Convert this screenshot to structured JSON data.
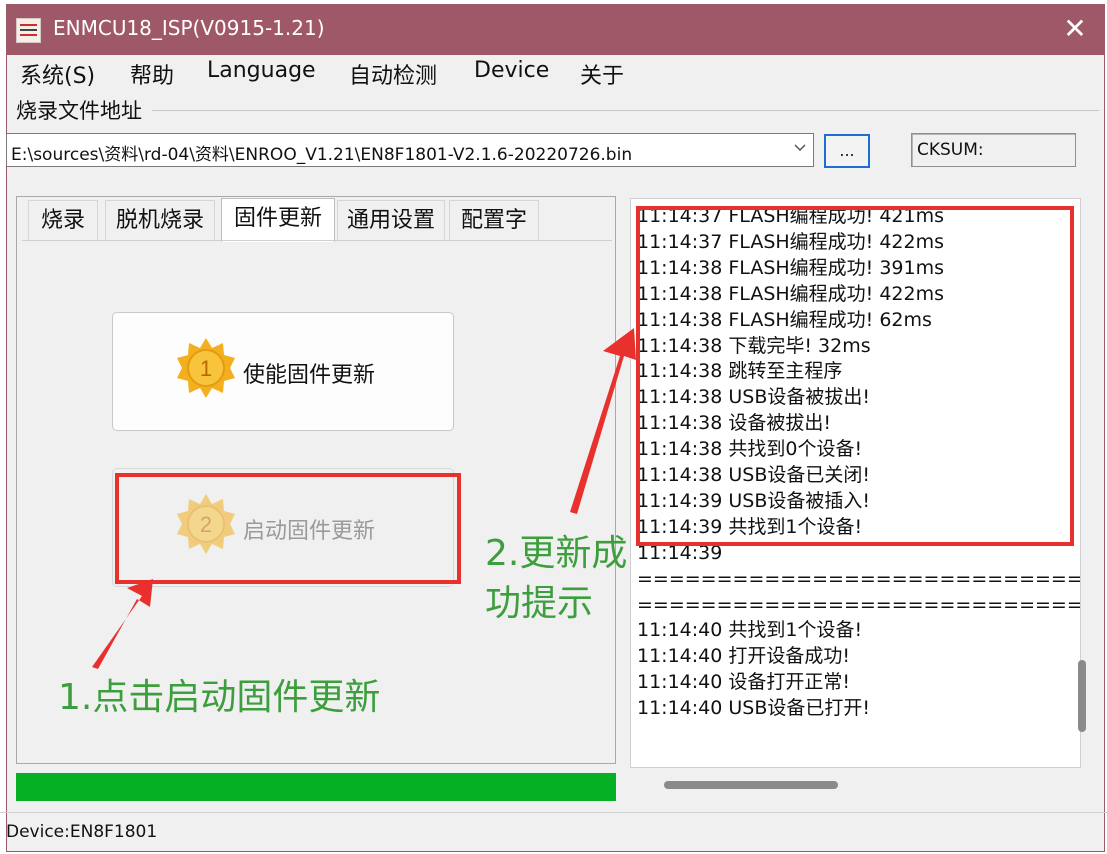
{
  "window": {
    "title": "ENMCU18_ISP(V0915-1.21)",
    "close_glyph": "✕",
    "accent": "#9f5867"
  },
  "menu": [
    "系统(S)",
    "帮助",
    "Language",
    "自动检测",
    "Device",
    "关于"
  ],
  "file_group": {
    "label": "烧录文件地址",
    "path": "E:\\sources\\资料\\rd-04\\资料\\ENROO_V1.21\\EN8F1801-V2.1.6-20220726.bin",
    "dropdown_icon": "chevron-down-icon",
    "browse_label": "...",
    "cksum_label": "CKSUM:"
  },
  "tabs": [
    "烧录",
    "脱机烧录",
    "固件更新",
    "通用设置",
    "配置字"
  ],
  "active_tab": "固件更新",
  "firmware": {
    "enable_button": {
      "badge": "1",
      "label": "使能固件更新"
    },
    "start_button": {
      "badge": "2",
      "label": "启动固件更新"
    }
  },
  "progress": {
    "fraction": 1.0,
    "color": "#06b025"
  },
  "log": [
    "11:14:37 FLASH编程成功! 421ms",
    "11:14:37 FLASH编程成功! 422ms",
    "11:14:38 FLASH编程成功! 391ms",
    "11:14:38 FLASH编程成功! 422ms",
    "11:14:38 FLASH编程成功! 62ms",
    "11:14:38 下载完毕! 32ms",
    "11:14:38 跳转至主程序",
    "11:14:38 USB设备被拔出!",
    "11:14:38 设备被拔出!",
    "11:14:38 共找到0个设备!",
    "11:14:38 USB设备已关闭!",
    "11:14:39 USB设备被插入!",
    "11:14:39 共找到1个设备!",
    "11:14:39",
    "============================",
    "============================",
    "11:14:40 共找到1个设备!",
    "11:14:40 打开设备成功!",
    "11:14:40 设备打开正常!",
    "11:14:40 USB设备已打开!"
  ],
  "status": {
    "device": "Device:EN8F1801"
  },
  "annotations": {
    "step1": "1.点击启动固件更新",
    "step2_line1": "2.更新成",
    "step2_line2": "功提示",
    "highlight_color": "#e8302d",
    "text_color": "#3c9e3c"
  }
}
